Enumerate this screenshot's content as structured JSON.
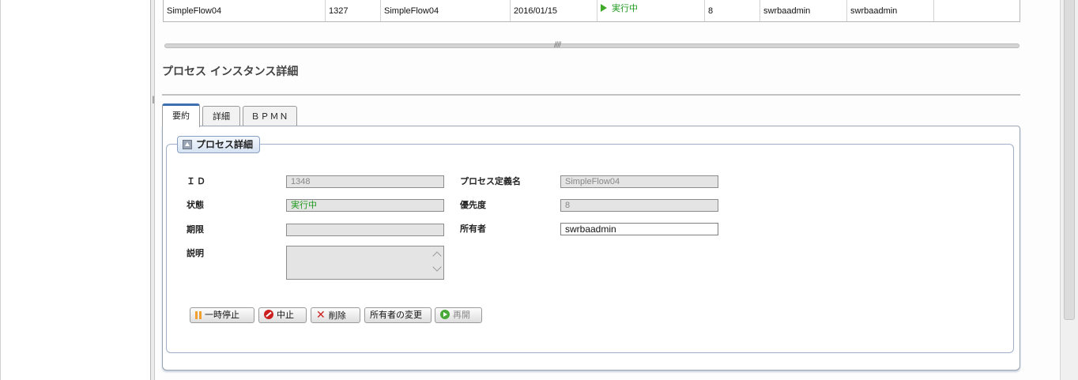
{
  "instance_row": {
    "process_name": "SimpleFlow04",
    "instance_id": "1327",
    "definition_name": "SimpleFlow04",
    "date": "2016/01/15",
    "status": "実行中",
    "priority": "8",
    "owner": "swrbaadmin",
    "creator": "swrbaadmin",
    "extra": ""
  },
  "splitter_grip": "////",
  "section_title": "プロセス インスタンス詳細",
  "tabs": [
    {
      "label": "要約",
      "active": true
    },
    {
      "label": "詳細",
      "active": false
    },
    {
      "label": "ＢＰＭＮ",
      "active": false
    }
  ],
  "panel_legend": "プロセス詳細",
  "fields": {
    "id_label": "ＩＤ",
    "id_value": "1348",
    "status_label": "状態",
    "status_value": "実行中",
    "due_label": "期限",
    "due_value": "",
    "description_label": "説明",
    "description_value": "",
    "definition_label": "プロセス定義名",
    "definition_value": "SimpleFlow04",
    "priority_label": "優先度",
    "priority_value": "8",
    "owner_label": "所有者",
    "owner_value": "swrbaadmin"
  },
  "buttons": {
    "suspend": "一時停止",
    "abort": "中止",
    "delete": "削除",
    "change_owner": "所有者の変更",
    "resume": "再開"
  },
  "colors": {
    "status_green": "#1e9a1e",
    "tab_accent": "#3d6fb0"
  },
  "icons": [
    "play-icon",
    "collapse-icon",
    "pause-icon",
    "stop-icon",
    "delete-icon",
    "resume-icon"
  ]
}
